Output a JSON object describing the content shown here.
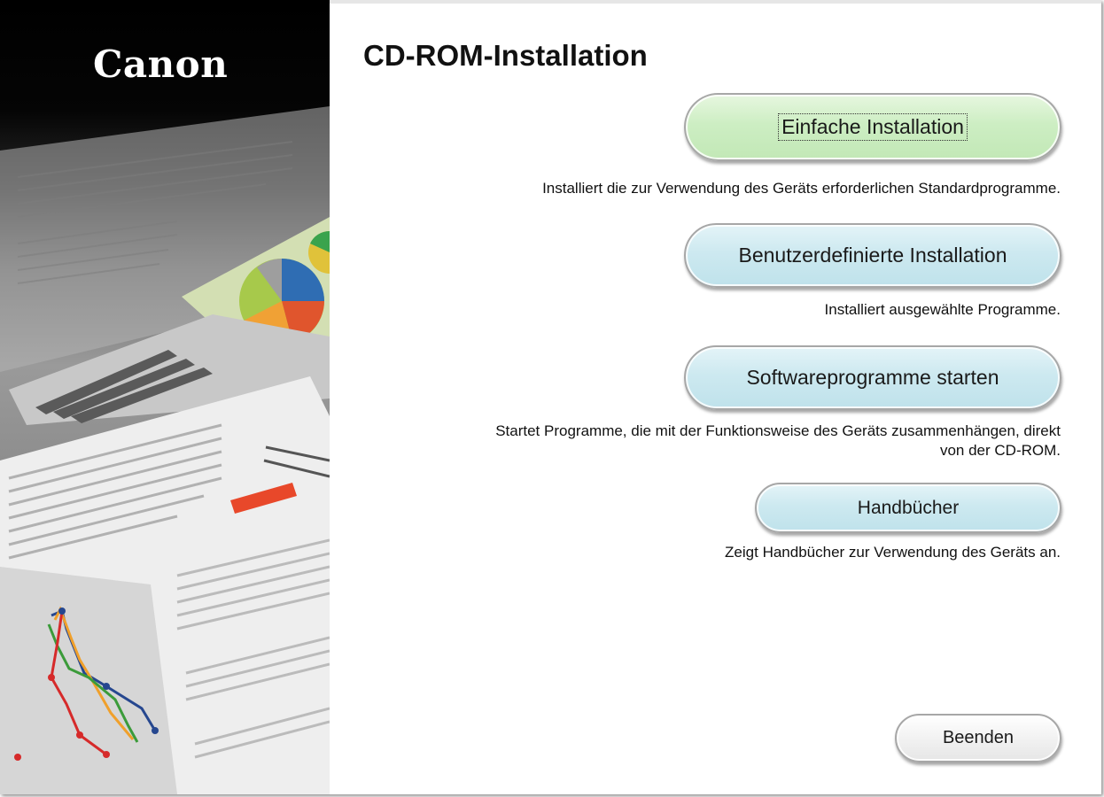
{
  "brand": {
    "logo": "Canon"
  },
  "window": {
    "title": "CD-ROM-Installation"
  },
  "options": [
    {
      "id": "easy",
      "label": "Einfache Installation",
      "description": "Installiert die zur Verwendung des Geräts erforderlichen Standardprogramme."
    },
    {
      "id": "custom",
      "label": "Benutzerdefinierte Installation",
      "description": "Installiert ausgewählte Programme."
    },
    {
      "id": "start",
      "label": "Softwareprogramme starten",
      "description_line1": "Startet Programme, die mit der Funktionsweise des Geräts zusammenhängen, direkt",
      "description_line2": "von der CD-ROM."
    },
    {
      "id": "manuals",
      "label": "Handbücher",
      "description": "Zeigt Handbücher zur Verwendung des Geräts an."
    }
  ],
  "exit_button": {
    "label": "Beenden"
  },
  "colors": {
    "primary_button": "#c6eabb",
    "secondary_button": "#c8e6ee",
    "sidebar_top": "#000000"
  }
}
